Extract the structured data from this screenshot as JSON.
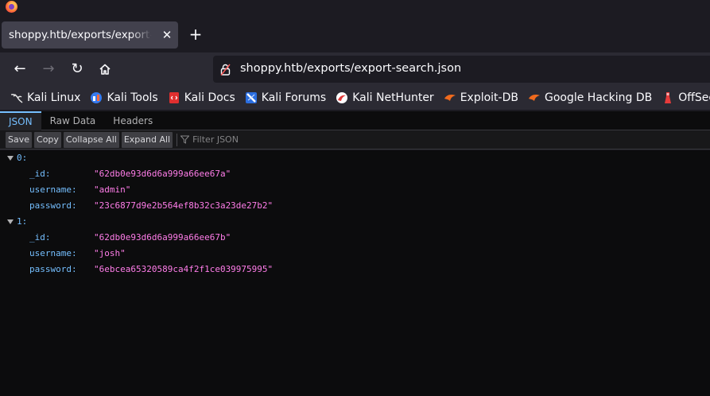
{
  "tab": {
    "title": "shoppy.htb/exports/export-search.json",
    "close_symbol": "✕",
    "new_tab_symbol": "+"
  },
  "nav": {
    "back_symbol": "←",
    "forward_symbol": "→",
    "reload_symbol": "↻",
    "home_icon": "home-icon",
    "url": "shoppy.htb/exports/export-search.json"
  },
  "bookmarks": [
    {
      "label": "Kali Linux",
      "icon": "kali-dragon-icon",
      "color": "#e6e6e6"
    },
    {
      "label": "Kali Tools",
      "icon": "kali-tools-icon",
      "color": "#367bf0"
    },
    {
      "label": "Kali Docs",
      "icon": "kali-docs-icon",
      "color": "#e02f2f"
    },
    {
      "label": "Kali Forums",
      "icon": "kali-forums-icon",
      "color": "#2b6ee0"
    },
    {
      "label": "Kali NetHunter",
      "icon": "nethunter-icon",
      "color": "#e03a3a"
    },
    {
      "label": "Exploit-DB",
      "icon": "exploit-db-icon",
      "color": "#f06a1d"
    },
    {
      "label": "Google Hacking DB",
      "icon": "ghdb-icon",
      "color": "#f06a1d"
    },
    {
      "label": "OffSec",
      "icon": "offsec-icon",
      "color": "#e63b3b"
    }
  ],
  "viewer": {
    "tabs": [
      "JSON",
      "Raw Data",
      "Headers"
    ],
    "buttons": {
      "save": "Save",
      "copy": "Copy",
      "collapse_all": "Collapse All",
      "expand_all": "Expand All"
    },
    "filter_placeholder": "Filter JSON"
  },
  "records": [
    {
      "index": "0:",
      "fields": [
        {
          "key": "_id:",
          "value": "\"62db0e93d6d6a999a66ee67a\""
        },
        {
          "key": "username:",
          "value": "\"admin\""
        },
        {
          "key": "password:",
          "value": "\"23c6877d9e2b564ef8b32c3a23de27b2\""
        }
      ]
    },
    {
      "index": "1:",
      "fields": [
        {
          "key": "_id:",
          "value": "\"62db0e93d6d6a999a66ee67b\""
        },
        {
          "key": "username:",
          "value": "\"josh\""
        },
        {
          "key": "password:",
          "value": "\"6ebcea65320589ca4f2f1ce039975995\""
        }
      ]
    }
  ],
  "colors": {
    "accent_tab": "#75bfff",
    "json_key": "#75bfff",
    "json_string": "#ff7de9"
  }
}
